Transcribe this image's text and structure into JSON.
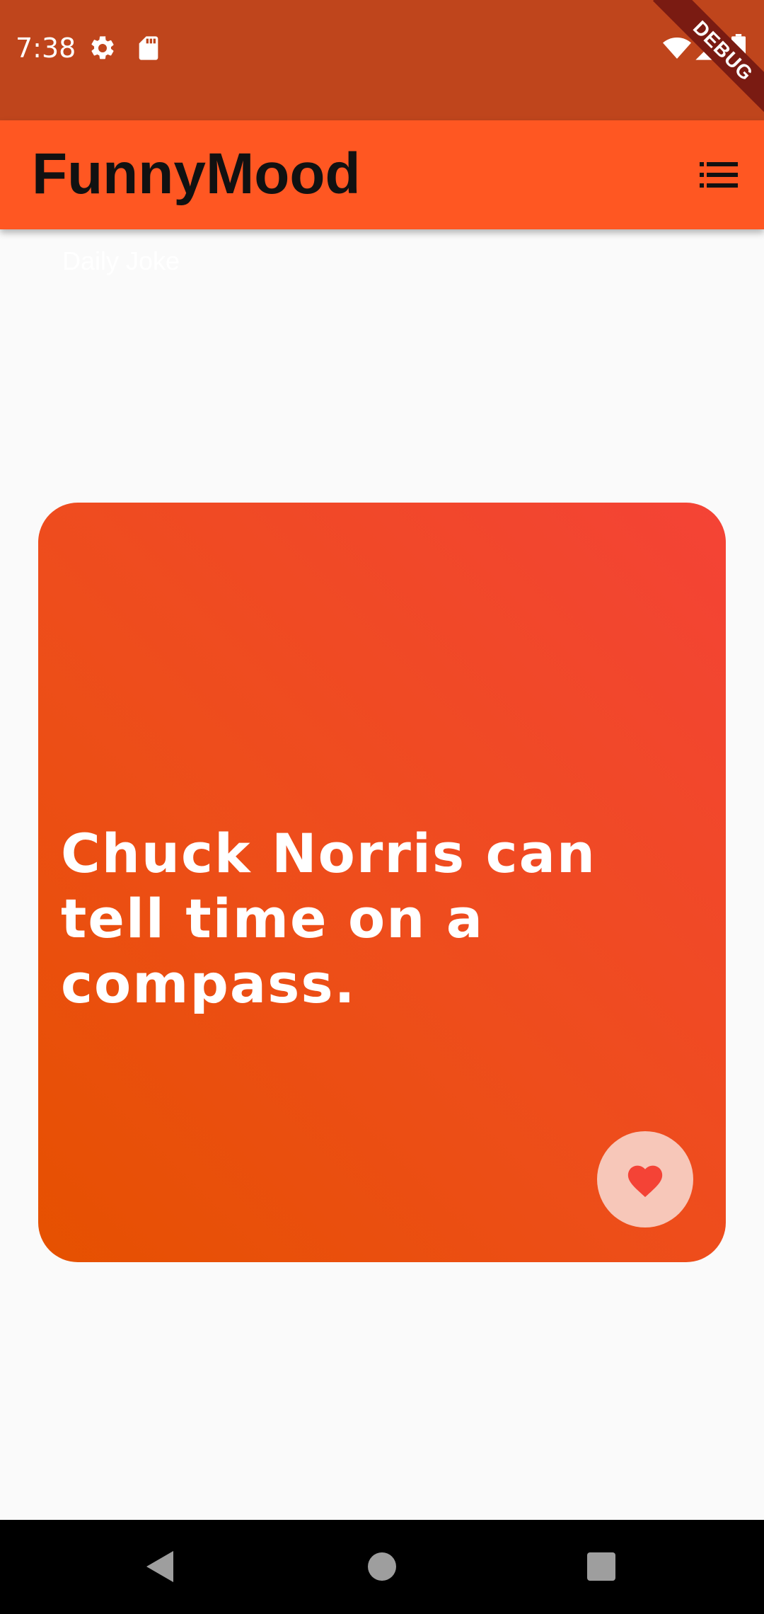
{
  "status_bar": {
    "time": "7:38",
    "icons": [
      "settings-icon",
      "sd-card-icon",
      "wifi-icon",
      "signal-icon",
      "battery-icon"
    ],
    "debug_label": "DEBUG"
  },
  "app_bar": {
    "title": "FunnyMood",
    "menu_icon": "list-icon",
    "color": "#ff5722"
  },
  "tab": {
    "label": "Daily Joke"
  },
  "joke_card": {
    "text": "Chuck Norris can tell time on a compass.",
    "favorite_icon": "heart-icon",
    "gradient_start": "#e65100",
    "gradient_end": "#f44336"
  },
  "nav_bar": {
    "buttons": [
      "back-icon",
      "home-icon",
      "recents-icon"
    ]
  },
  "colors": {
    "status_bar": "#bf451c",
    "background": "#fafafa",
    "heart": "#f44336",
    "favorite_bg": "#f7c7b9"
  }
}
